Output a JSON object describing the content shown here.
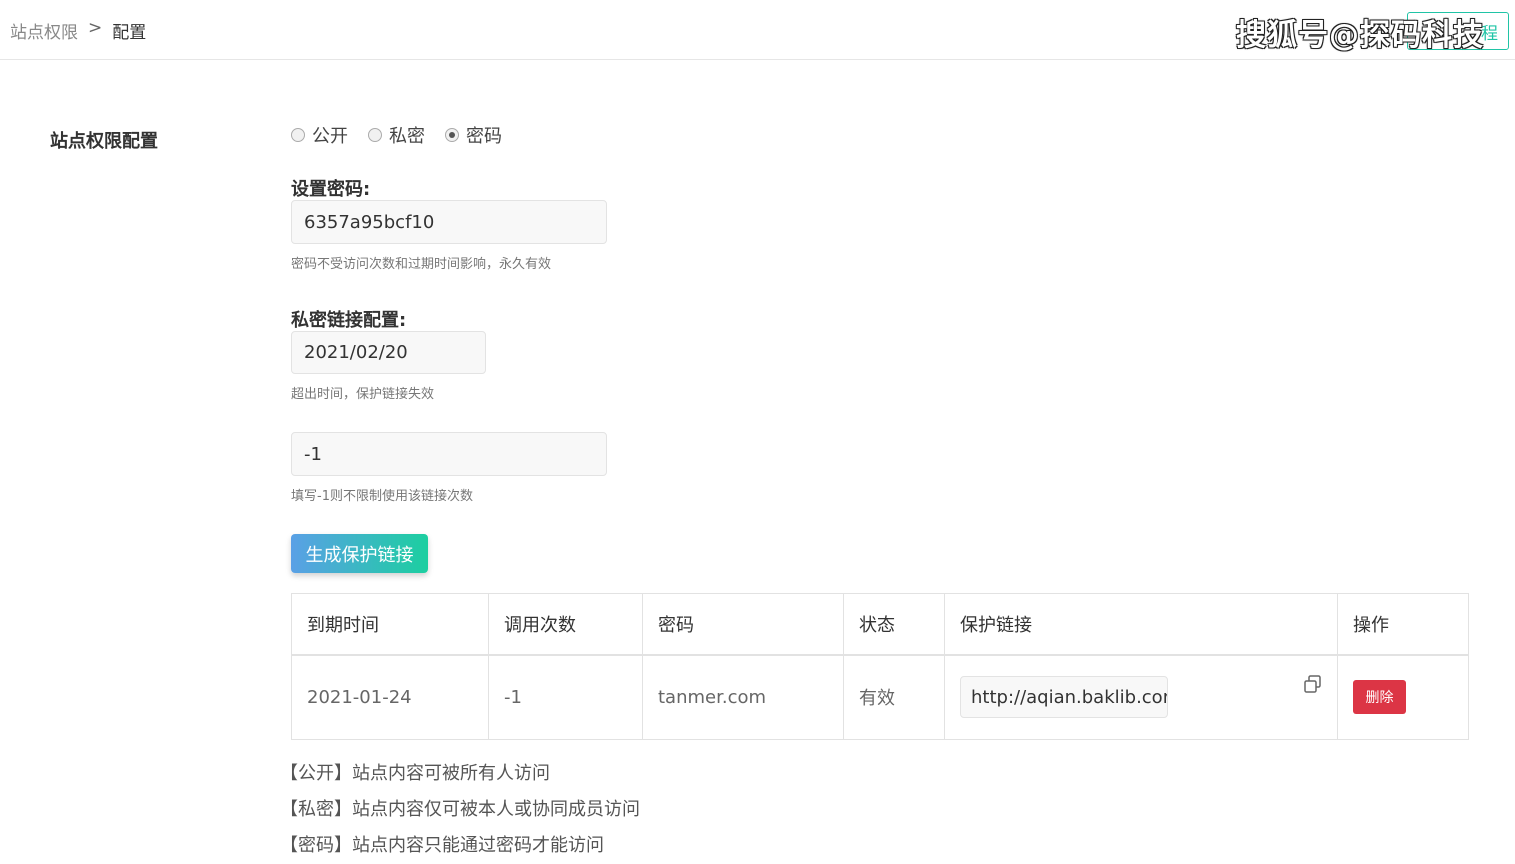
{
  "breadcrumb": {
    "parent": "站点权限",
    "separator": ">",
    "current": "配置"
  },
  "help_button": {
    "label": "使用教程",
    "visible_text": "程"
  },
  "watermark": "搜狐号@探码科技",
  "section_title": "站点权限配置",
  "access_options": [
    {
      "label": "公开",
      "selected": false
    },
    {
      "label": "私密",
      "selected": false
    },
    {
      "label": "密码",
      "selected": true
    }
  ],
  "password": {
    "label": "设置密码:",
    "value": "6357a95bcf10",
    "hint": "密码不受访问次数和过期时间影响，永久有效"
  },
  "private_link": {
    "label": "私密链接配置:",
    "expire_date": "2021/02/20",
    "expire_hint": "超出时间，保护链接失效",
    "usage_count": "-1",
    "usage_hint": "填写-1则不限制使用该链接次数"
  },
  "generate_button": "生成保护链接",
  "table": {
    "headers": [
      "到期时间",
      "调用次数",
      "密码",
      "状态",
      "保护链接",
      "操作"
    ],
    "rows": [
      {
        "expire": "2021-01-24",
        "count": "-1",
        "password": "tanmer.com",
        "status": "有效",
        "link": "http://aqian.baklib.com",
        "action": "删除"
      }
    ]
  },
  "notes": [
    "【公开】站点内容可被所有人访问",
    "【私密】站点内容仅可被本人或协同成员访问",
    "【密码】站点内容只能通过密码才能访问"
  ],
  "colors": {
    "accent": "#20c4a6",
    "danger": "#dc3545",
    "gradient_start": "#5aa0e6",
    "gradient_end": "#1ccfa0"
  }
}
